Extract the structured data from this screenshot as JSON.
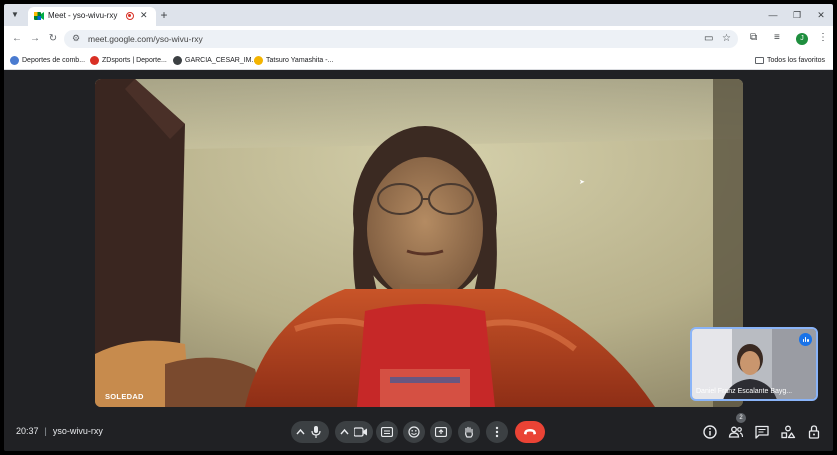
{
  "browser": {
    "tab_title": "Meet - yso-wivu-rxy",
    "url": "meet.google.com/yso-wivu-rxy",
    "profile_initial": "J",
    "bookmarks": [
      {
        "label": "Deportes de comb...",
        "color": "#4a7bd0"
      },
      {
        "label": "ZDsports | Deporte...",
        "color": "#d93025"
      },
      {
        "label": "GARCIA_CESAR_IM...",
        "color": "#3c4043"
      },
      {
        "label": "Tatsuro Yamashita -...",
        "color": "#f4b400"
      }
    ],
    "all_bookmarks_label": "Todos los favoritos"
  },
  "meeting": {
    "time": "20:37",
    "code": "yso-wivu-rxy",
    "speaker_name": "SOLEDAD",
    "self_name": "Daniel Franz Escalante Bayg...",
    "participant_count": "2"
  },
  "colors": {
    "accent": "#8ab4f8",
    "end_call": "#ea4335",
    "control_bg": "#3c4043",
    "background": "#202124"
  },
  "icons": {
    "mic": "mic-icon",
    "camera": "camera-icon",
    "captions": "captions-icon",
    "emoji": "emoji-icon",
    "present": "present-icon",
    "hand": "raise-hand-icon",
    "more": "more-vert-icon",
    "end": "call-end-icon",
    "info": "info-icon",
    "people": "people-icon",
    "chat": "chat-icon",
    "activities": "activities-icon",
    "host": "host-controls-icon"
  }
}
